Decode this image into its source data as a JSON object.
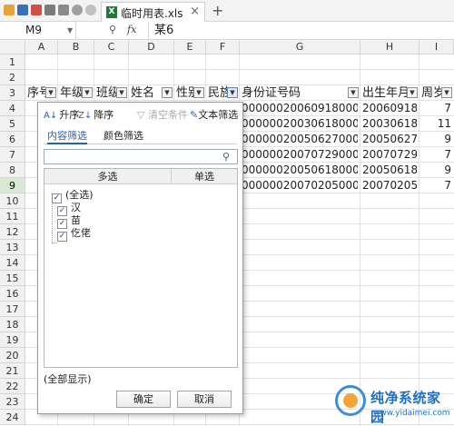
{
  "window": {
    "tab_title": "临时用表.xls",
    "tab_close": "×",
    "tab_add": "+",
    "tab_icon_text": "X"
  },
  "formula_bar": {
    "cell_ref": "M9",
    "zoom_icon": "⚲",
    "fx_label": "fx",
    "value": "某6"
  },
  "columns": [
    "A",
    "B",
    "C",
    "D",
    "E",
    "F",
    "G",
    "H",
    "I"
  ],
  "rows": [
    "1",
    "2",
    "3",
    "4",
    "5",
    "6",
    "7",
    "8",
    "9",
    "10",
    "11",
    "12",
    "13",
    "14",
    "15",
    "16",
    "17",
    "18",
    "19",
    "20",
    "21",
    "22",
    "23",
    "24"
  ],
  "active_row": "9",
  "header_row": [
    "序号",
    "年级",
    "班级",
    "姓名",
    "性别",
    "民族",
    "身份证号码",
    "出生年月",
    "周岁"
  ],
  "data_rows": [
    {
      "id": "000000200609180000",
      "birth": "20060918",
      "age": "7"
    },
    {
      "id": "000000200306180000",
      "birth": "20030618",
      "age": "11"
    },
    {
      "id": "000000200506270000",
      "birth": "20050627",
      "age": "9"
    },
    {
      "id": "000000200707290000",
      "birth": "20070729",
      "age": "7"
    },
    {
      "id": "000000200506180000",
      "birth": "20050618",
      "age": "9"
    },
    {
      "id": "000000200702050000",
      "birth": "20070205",
      "age": "7"
    }
  ],
  "filter_popup": {
    "sort_asc": "升序",
    "sort_desc": "降序",
    "clear": "清空条件",
    "text_filter": "文本筛选",
    "tabs": [
      "内容筛选",
      "颜色筛选"
    ],
    "search_placeholder": "",
    "list_head_multi": "多选",
    "list_head_single": "单选",
    "items": [
      {
        "label": "(全选)",
        "checked": true
      },
      {
        "label": "汉",
        "checked": true
      },
      {
        "label": "苗",
        "checked": true
      },
      {
        "label": "仡佬",
        "checked": true
      }
    ],
    "show_all": "(全部显示)",
    "ok": "确定",
    "cancel": "取消"
  },
  "watermark": {
    "title": "纯净系统家园",
    "url": "www.yidaimei.com"
  }
}
